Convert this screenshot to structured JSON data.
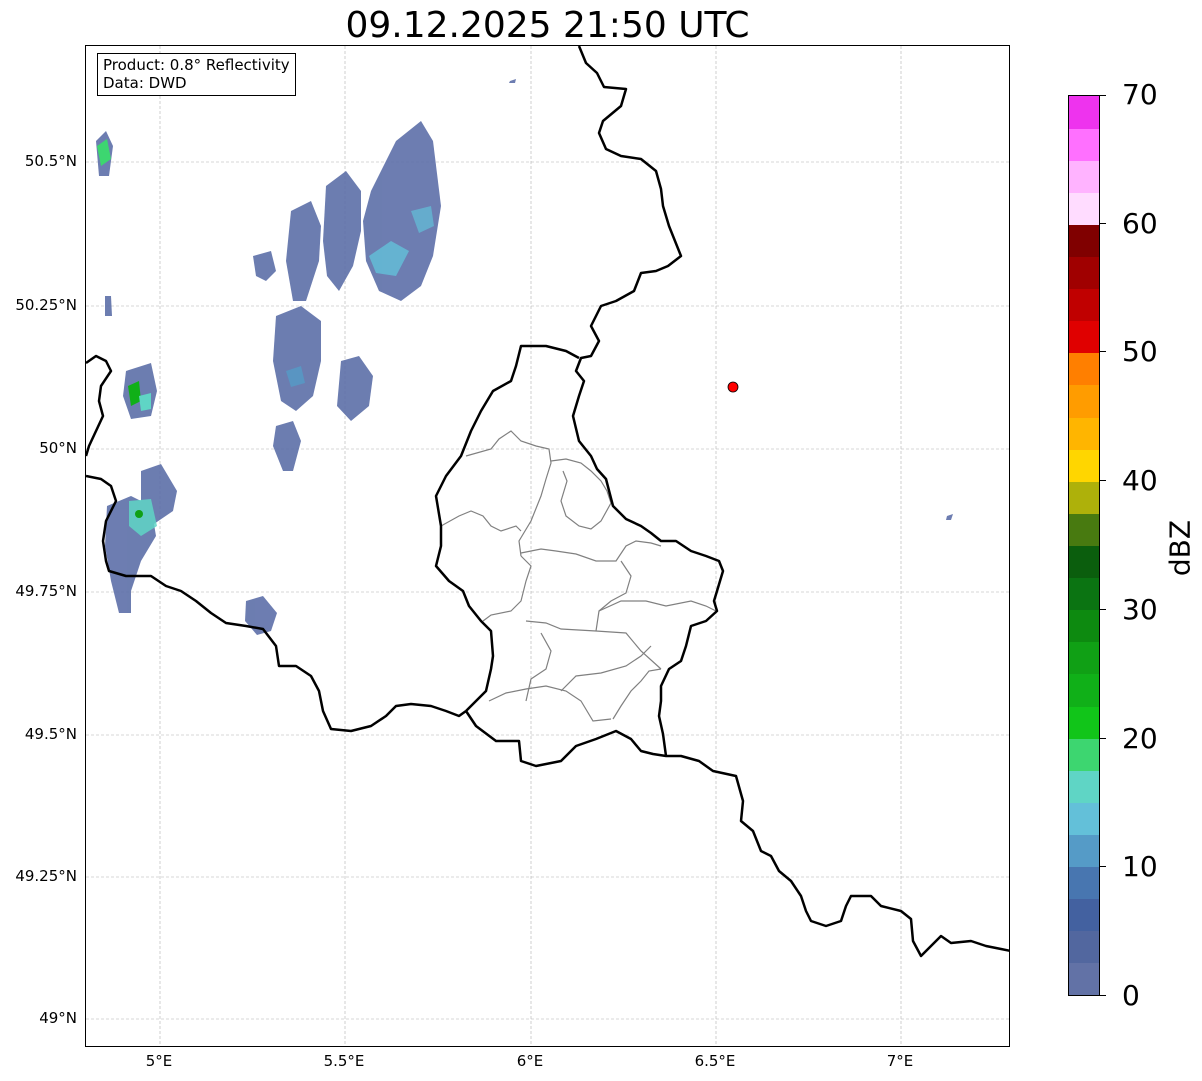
{
  "title": "09.12.2025 21:50 UTC",
  "info_box": {
    "product": "Product: 0.8° Reflectivity",
    "data": "Data: DWD"
  },
  "axes": {
    "lon_ticks": [
      "5°E",
      "5.5°E",
      "6°E",
      "6.5°E",
      "7°E"
    ],
    "lat_ticks": [
      "50.5°N",
      "50.25°N",
      "50°N",
      "49.75°N",
      "49.5°N",
      "49.25°N",
      "49°N"
    ]
  },
  "colorbar": {
    "label": "dBZ",
    "ticks": [
      "0",
      "10",
      "20",
      "30",
      "40",
      "50",
      "60",
      "70"
    ],
    "colors": [
      "#6272a6",
      "#52679f",
      "#4361a0",
      "#4876b0",
      "#559bc7",
      "#63c0d9",
      "#5fd5c5",
      "#3dd670",
      "#11c519",
      "#10b018",
      "#10a015",
      "#0d8a10",
      "#0b7412",
      "#0b5e0d",
      "#487a10",
      "#aeb10a",
      "#ffd600",
      "#ffb500",
      "#ff9c00",
      "#ff7f00",
      "#e00000",
      "#c00000",
      "#a00000",
      "#800000",
      "#ffdcff",
      "#ffb3ff",
      "#ff70ff",
      "#ee33ee"
    ]
  },
  "colors": {
    "border": "#000000",
    "admin_border": "#808080",
    "gridline": "#b0b0b0",
    "radar_site": "#ff0000"
  },
  "icons": {
    "radar_site": "radar-site-marker"
  }
}
